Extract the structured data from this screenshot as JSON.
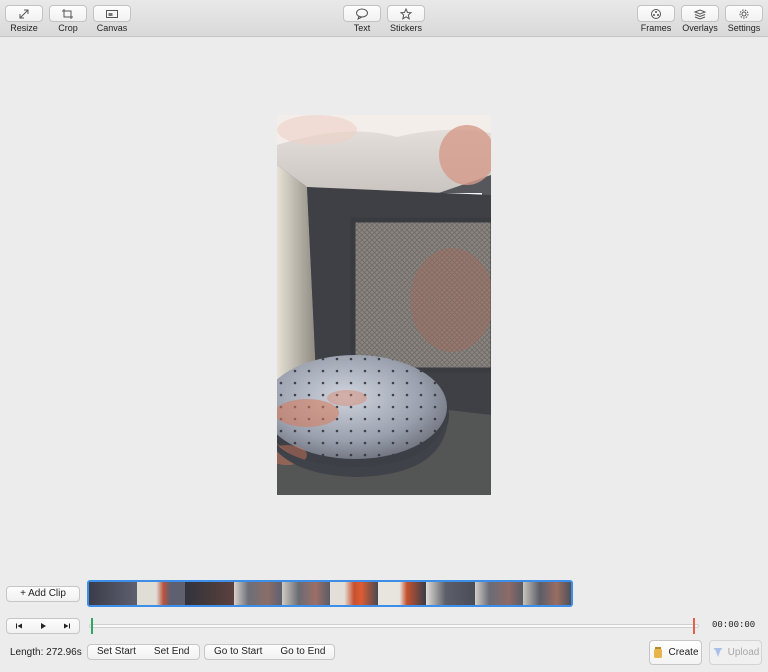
{
  "toolbar": {
    "left": [
      {
        "label": "Resize",
        "icon": "resize-icon"
      },
      {
        "label": "Crop",
        "icon": "crop-icon"
      },
      {
        "label": "Canvas",
        "icon": "canvas-icon"
      }
    ],
    "center": [
      {
        "label": "Text",
        "icon": "speech-bubble-icon"
      },
      {
        "label": "Stickers",
        "icon": "star-icon"
      }
    ],
    "right": [
      {
        "label": "Frames",
        "icon": "film-reel-icon"
      },
      {
        "label": "Overlays",
        "icon": "layers-icon"
      },
      {
        "label": "Settings",
        "icon": "gear-icon"
      }
    ]
  },
  "clips": {
    "add_label": "+ Add Clip",
    "frame_count": 10
  },
  "transport": {
    "prev_icon": "skip-back-icon",
    "play_icon": "play-icon",
    "next_icon": "skip-forward-icon"
  },
  "timeline": {
    "timecode": "00:00:00",
    "start_color": "#2ba866",
    "end_color": "#e0604f"
  },
  "footer": {
    "length_label": "Length: 272.96s",
    "set_start": "Set Start",
    "set_end": "Set End",
    "go_to_start": "Go to Start",
    "go_to_end": "Go to End",
    "create": "Create",
    "upload": "Upload"
  },
  "colors": {
    "accent": "#3d8ee8"
  }
}
